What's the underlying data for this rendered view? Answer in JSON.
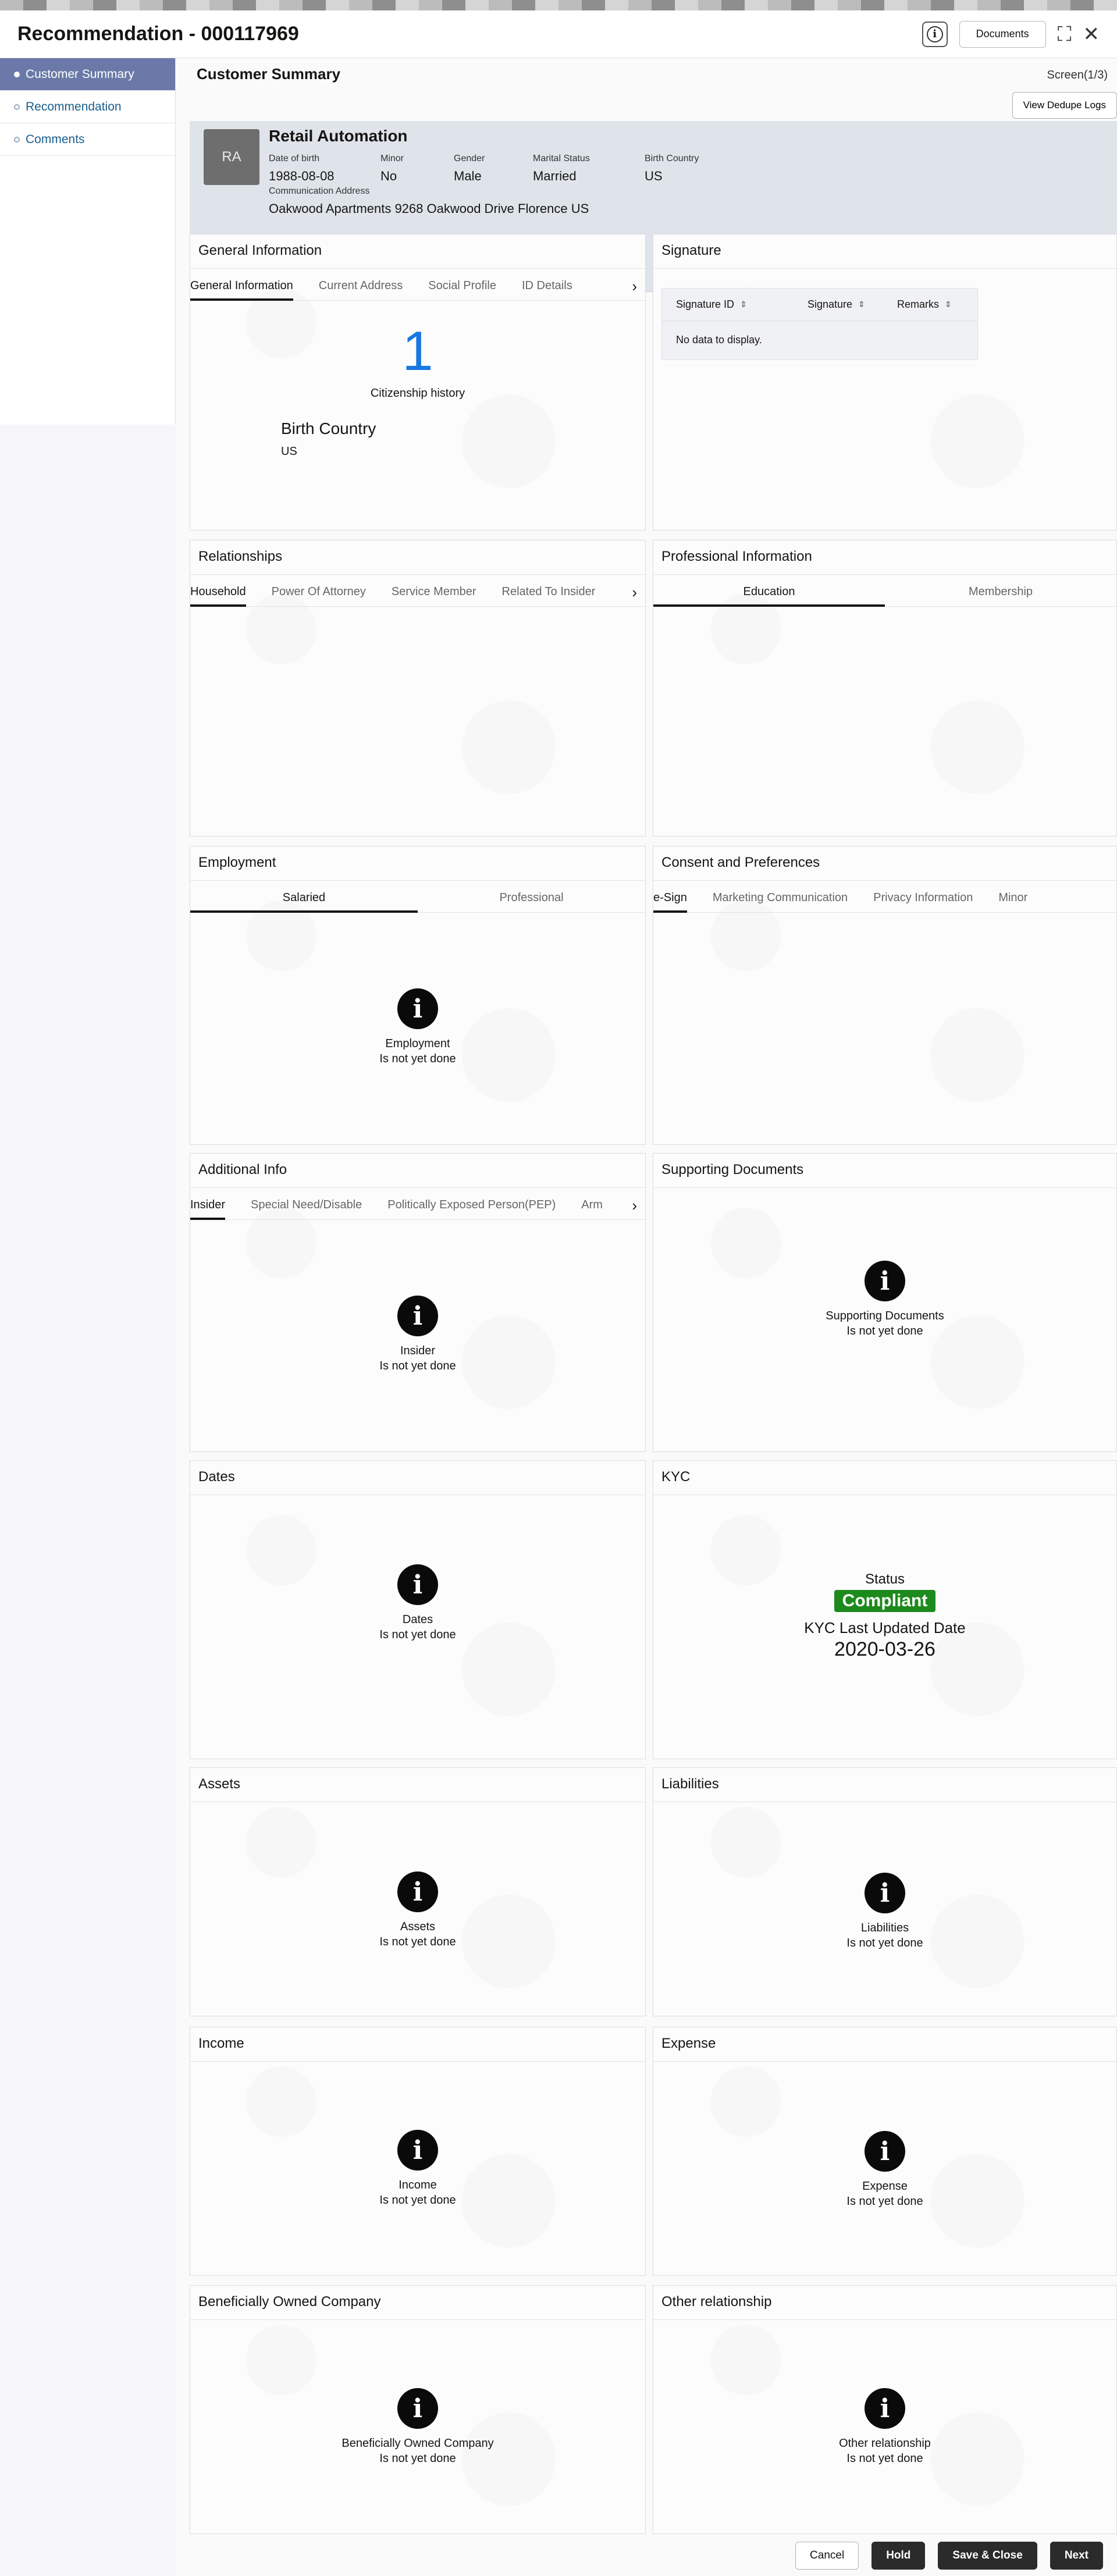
{
  "header": {
    "title": "Recommendation - 000117969",
    "documents_label": "Documents",
    "info_glyph": "i",
    "expand_glyph": "⛶",
    "close_glyph": "✕"
  },
  "sidebar": {
    "items": [
      {
        "label": "Customer Summary"
      },
      {
        "label": "Recommendation"
      },
      {
        "label": "Comments"
      }
    ]
  },
  "page": {
    "title": "Customer Summary",
    "screen_count": "Screen(1/3)",
    "dedupe_label": "View Dedupe Logs"
  },
  "customer": {
    "initials": "RA",
    "name": "Retail Automation",
    "dob_label": "Date of birth",
    "dob": "1988-08-08",
    "minor_label": "Minor",
    "minor": "No",
    "gender_label": "Gender",
    "gender": "Male",
    "marital_label": "Marital Status",
    "marital": "Married",
    "birth_country_label": "Birth Country",
    "birth_country": "US",
    "address_label": "Communication Address",
    "address": "Oakwood Apartments 9268 Oakwood Drive Florence US"
  },
  "general_info": {
    "title": "General Information",
    "tabs": [
      "General Information",
      "Current Address",
      "Social Profile",
      "ID Details"
    ],
    "citizenship_count": "1",
    "citizenship_label": "Citizenship history",
    "birth_country_label": "Birth Country",
    "birth_country": "US"
  },
  "signature": {
    "title": "Signature",
    "columns": [
      "Signature ID",
      "Signature",
      "Remarks"
    ],
    "empty": "No data to display."
  },
  "relationships": {
    "title": "Relationships",
    "tabs": [
      "Household",
      "Power Of Attorney",
      "Service Member",
      "Related To Insider"
    ]
  },
  "professional": {
    "title": "Professional Information",
    "tabs": [
      "Education",
      "Membership"
    ]
  },
  "employment": {
    "title": "Employment",
    "tabs": [
      "Salaried",
      "Professional"
    ],
    "empty_name": "Employment",
    "empty_status": "Is not yet done"
  },
  "consent": {
    "title": "Consent and Preferences",
    "tabs": [
      "e-Sign",
      "Marketing Communication",
      "Privacy Information",
      "Minor"
    ]
  },
  "additional_info": {
    "title": "Additional Info",
    "tabs": [
      "Insider",
      "Special Need/Disable",
      "Politically Exposed Person(PEP)",
      "Arm"
    ],
    "empty_name": "Insider",
    "empty_status": "Is not yet done"
  },
  "supporting_docs": {
    "title": "Supporting Documents",
    "empty_name": "Supporting Documents",
    "empty_status": "Is not yet done"
  },
  "dates": {
    "title": "Dates",
    "empty_name": "Dates",
    "empty_status": "Is not yet done"
  },
  "kyc": {
    "title": "KYC",
    "status_label": "Status",
    "status": "Compliant",
    "status_color": "#1d8a1d",
    "updated_label": "KYC Last Updated Date",
    "updated": "2020-03-26"
  },
  "assets": {
    "title": "Assets",
    "empty_name": "Assets",
    "empty_status": "Is not yet done"
  },
  "liabilities": {
    "title": "Liabilities",
    "empty_name": "Liabilities",
    "empty_status": "Is not yet done"
  },
  "income": {
    "title": "Income",
    "empty_name": "Income",
    "empty_status": "Is not yet done"
  },
  "expense": {
    "title": "Expense",
    "empty_name": "Expense",
    "empty_status": "Is not yet done"
  },
  "beneficial": {
    "title": "Beneficially Owned Company",
    "empty_name": "Beneficially Owned Company",
    "empty_status": "Is not yet done"
  },
  "other_rel": {
    "title": "Other relationship",
    "empty_name": "Other relationship",
    "empty_status": "Is not yet done"
  },
  "footer": {
    "cancel": "Cancel",
    "hold": "Hold",
    "save_close": "Save & Close",
    "next": "Next"
  },
  "icons": {
    "info": "i",
    "chevron_right": "›",
    "sort": "⇕"
  }
}
